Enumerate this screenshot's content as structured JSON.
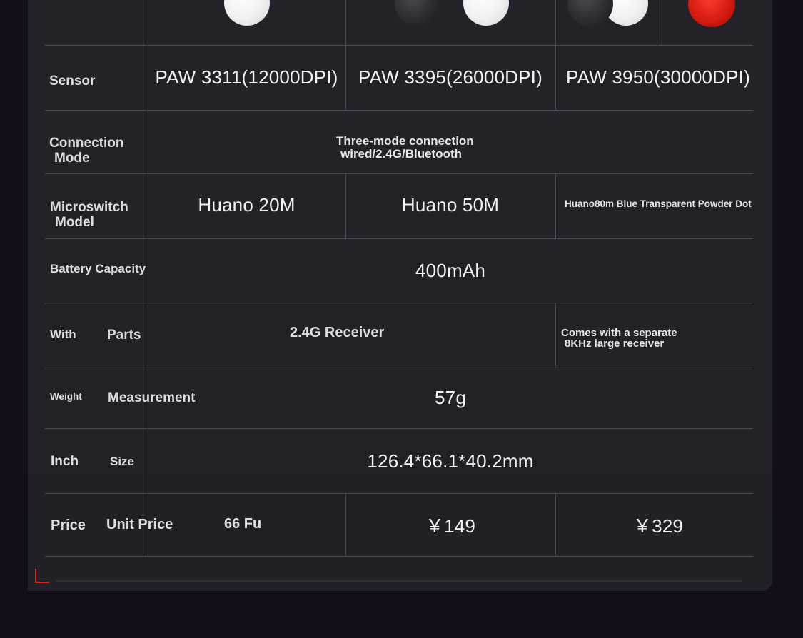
{
  "colors": {
    "background": "#140e18",
    "panel": "#232228",
    "grid": "#4b4a52",
    "accent": "#d2261c"
  },
  "icons": [
    "mouse-white-icon",
    "mouse-black-icon",
    "mouse-red-icon",
    "corner-bracket-icon"
  ],
  "rows": {
    "sensor": {
      "label": "Sensor",
      "values": [
        "PAW 3311(12000DPI)",
        "PAW 3395(26000DPI)",
        "PAW 3950(30000DPI)"
      ]
    },
    "connection": {
      "label_line1": "Connection",
      "label_line2": "Mode",
      "value_line1": "Three-mode connection",
      "value_line2": "wired/2.4G/Bluetooth"
    },
    "microswitch": {
      "label_line1": "Microswitch",
      "label_line2": "Model",
      "values": [
        "Huano 20M",
        "Huano 50M",
        "Huano80m Blue Transparent Powder Dot"
      ]
    },
    "battery": {
      "label": "Battery Capacity",
      "value": "400mAh"
    },
    "parts": {
      "label_a": "With",
      "label_b": "Parts",
      "value": "2.4G Receiver",
      "extra_line1": "Comes with a separate",
      "extra_line2": "8KHz large receiver"
    },
    "weight": {
      "label_a": "Weight",
      "label_b": "Measurement",
      "value": "57g"
    },
    "size": {
      "label_a": "Inch",
      "label_b": "Size",
      "value": "126.4*66.1*40.2mm"
    },
    "price": {
      "label_a": "Price",
      "label_b": "Unit Price",
      "values": [
        "66 Fu",
        "￥149",
        "￥329"
      ]
    }
  }
}
